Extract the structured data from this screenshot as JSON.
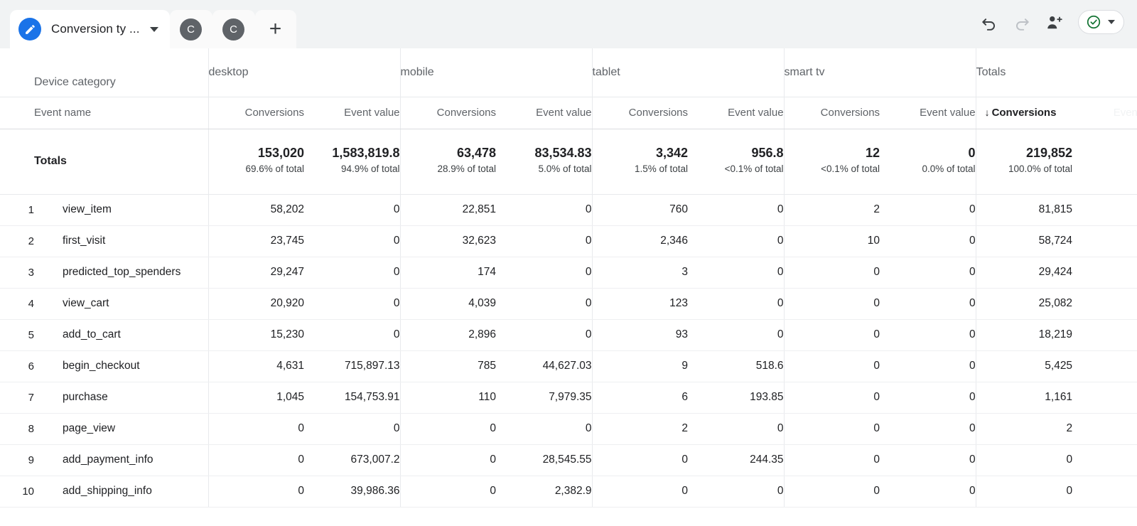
{
  "topbar": {
    "doc_icon": "pencil-circle-icon",
    "title": "Conversion ty ...",
    "caret_icon": "chevron-down-icon",
    "tabs": [
      {
        "label": "C",
        "icon": "avatar-c-icon"
      },
      {
        "label": "C",
        "icon": "avatar-c-icon"
      }
    ],
    "add_tab_label": "+",
    "undo_icon": "undo-icon",
    "redo_icon": "redo-icon",
    "share_icon": "add-person-icon",
    "status_icon": "green-check-circle-icon",
    "status_caret_icon": "chevron-down-icon",
    "accent_color": "#1a73e8",
    "status_color": "#137333"
  },
  "table": {
    "dimension_label": "Device category",
    "row_label_header": "Event name",
    "groups": [
      {
        "label": "desktop"
      },
      {
        "label": "mobile"
      },
      {
        "label": "tablet"
      },
      {
        "label": "smart tv"
      },
      {
        "label": "Totals"
      }
    ],
    "metrics": {
      "conversions": "Conversions",
      "event_value": "Event value"
    },
    "sorted_metric": "Conversions",
    "sort_arrow": "↓",
    "cutoff_metric": "Event value",
    "cutoff_row_index": "10",
    "totals": {
      "label": "Totals",
      "cells": [
        {
          "value": "153,020",
          "sub": "69.6% of total"
        },
        {
          "value": "1,583,819.8",
          "sub": "94.9% of total"
        },
        {
          "value": "63,478",
          "sub": "28.9% of total"
        },
        {
          "value": "83,534.83",
          "sub": "5.0% of total"
        },
        {
          "value": "3,342",
          "sub": "1.5% of total"
        },
        {
          "value": "956.8",
          "sub": "<0.1% of total"
        },
        {
          "value": "12",
          "sub": "<0.1% of total"
        },
        {
          "value": "0",
          "sub": "0.0% of total"
        },
        {
          "value": "219,852",
          "sub": "100.0% of total"
        }
      ]
    },
    "rows": [
      {
        "idx": "1",
        "name": "view_item",
        "cells": [
          "58,202",
          "0",
          "22,851",
          "0",
          "760",
          "0",
          "2",
          "0",
          "81,815"
        ]
      },
      {
        "idx": "2",
        "name": "first_visit",
        "cells": [
          "23,745",
          "0",
          "32,623",
          "0",
          "2,346",
          "0",
          "10",
          "0",
          "58,724"
        ]
      },
      {
        "idx": "3",
        "name": "predicted_top_spenders",
        "cells": [
          "29,247",
          "0",
          "174",
          "0",
          "3",
          "0",
          "0",
          "0",
          "29,424"
        ]
      },
      {
        "idx": "4",
        "name": "view_cart",
        "cells": [
          "20,920",
          "0",
          "4,039",
          "0",
          "123",
          "0",
          "0",
          "0",
          "25,082"
        ]
      },
      {
        "idx": "5",
        "name": "add_to_cart",
        "cells": [
          "15,230",
          "0",
          "2,896",
          "0",
          "93",
          "0",
          "0",
          "0",
          "18,219"
        ]
      },
      {
        "idx": "6",
        "name": "begin_checkout",
        "cells": [
          "4,631",
          "715,897.13",
          "785",
          "44,627.03",
          "9",
          "518.6",
          "0",
          "0",
          "5,425"
        ]
      },
      {
        "idx": "7",
        "name": "purchase",
        "cells": [
          "1,045",
          "154,753.91",
          "110",
          "7,979.35",
          "6",
          "193.85",
          "0",
          "0",
          "1,161"
        ]
      },
      {
        "idx": "8",
        "name": "page_view",
        "cells": [
          "0",
          "0",
          "0",
          "0",
          "2",
          "0",
          "0",
          "0",
          "2"
        ]
      },
      {
        "idx": "9",
        "name": "add_payment_info",
        "cells": [
          "0",
          "673,007.2",
          "0",
          "28,545.55",
          "0",
          "244.35",
          "0",
          "0",
          "0"
        ]
      },
      {
        "idx": "10",
        "name": "add_shipping_info",
        "cells": [
          "0",
          "39,986.36",
          "0",
          "2,382.9",
          "0",
          "0",
          "0",
          "0",
          "0"
        ]
      }
    ]
  }
}
